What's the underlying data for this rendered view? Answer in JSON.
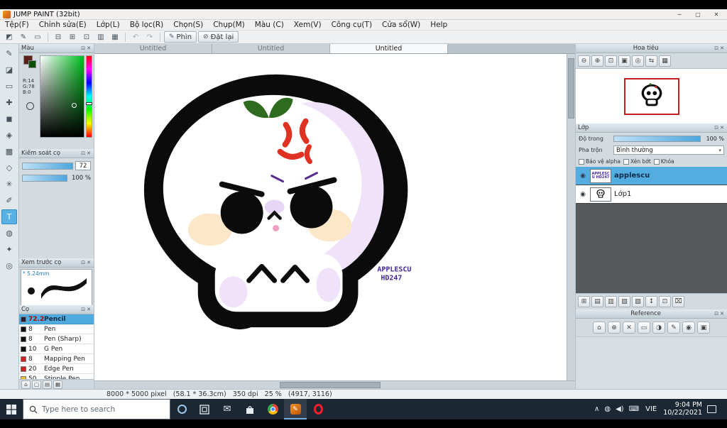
{
  "window": {
    "title": "JUMP PAINT (32bit)",
    "controls": {
      "minimize": "─",
      "maximize": "▢",
      "close": "✕"
    }
  },
  "ui": {
    "float_glyph": "⊡",
    "close_glyph": "✕"
  },
  "menu": {
    "items": [
      "Tệp(F)",
      "Chỉnh sửa(E)",
      "Lớp(L)",
      "Bộ lọc(R)",
      "Chọn(S)",
      "Chụp(M)",
      "Màu (C)",
      "Xem(V)",
      "Công cụ(T)",
      "Cửa sổ(W)",
      "Help"
    ]
  },
  "toolbar": {
    "icons": [
      {
        "name": "palette-icon",
        "glyph": "◩"
      },
      {
        "name": "brush-settings-icon",
        "glyph": "✎"
      },
      {
        "name": "comment-icon",
        "glyph": "▭"
      },
      {
        "name": "layout-left-icon",
        "glyph": "⊟"
      },
      {
        "name": "layout-grid-icon",
        "glyph": "⊞"
      },
      {
        "name": "layout-right-icon",
        "glyph": "⊡"
      },
      {
        "name": "layout-rows-icon",
        "glyph": "▥"
      },
      {
        "name": "materials-icon",
        "glyph": "▦"
      }
    ],
    "undo_glyph": "↶",
    "redo_glyph": "↷",
    "pen_glyph": "✎",
    "pen_button": "Phìn",
    "reset_glyph": "⊘",
    "reset_button": "Đặt lại"
  },
  "tools": {
    "items": [
      {
        "name": "pen-tool",
        "glyph": "✎"
      },
      {
        "name": "eraser-tool",
        "glyph": "◪"
      },
      {
        "name": "marquee-tool",
        "glyph": "▭"
      },
      {
        "name": "move-tool",
        "glyph": "✚"
      },
      {
        "name": "fill-tool",
        "glyph": "◼"
      },
      {
        "name": "bucket-tool",
        "glyph": "◈"
      },
      {
        "name": "gradient-tool",
        "glyph": "▩"
      },
      {
        "name": "lasso-tool",
        "glyph": "◇"
      },
      {
        "name": "wand-tool",
        "glyph": "✳"
      },
      {
        "name": "select-pen-tool",
        "glyph": "✐"
      },
      {
        "name": "text-tool",
        "glyph": "T",
        "active": true
      },
      {
        "name": "eyedropper-tool",
        "glyph": "◍"
      },
      {
        "name": "hand-tool",
        "glyph": "✦"
      },
      {
        "name": "zoom-tool",
        "glyph": "◎"
      }
    ]
  },
  "color_panel": {
    "title": "Màu",
    "r": "R:14",
    "g": "G:78",
    "b": "B:0",
    "foreground_swatch": "#0e4e00"
  },
  "brush_control": {
    "title": "Kiểm soát cọ",
    "size_value": "72",
    "opacity_value": "100 %"
  },
  "brush_preview": {
    "title": "Xem trước cọ",
    "size_label": "* 5.24mm"
  },
  "brush_list": {
    "title": "Cọ",
    "brushes": [
      {
        "size": "72.2",
        "name": "Pencil",
        "swatch": "#20203a",
        "selected": true
      },
      {
        "size": "8",
        "name": "Pen",
        "swatch": "#101010",
        "selected": false
      },
      {
        "size": "8",
        "name": "Pen (Sharp)",
        "swatch": "#101010",
        "selected": false
      },
      {
        "size": "10",
        "name": "G Pen",
        "swatch": "#101010",
        "selected": false
      },
      {
        "size": "8",
        "name": "Mapping Pen",
        "swatch": "#cc2222",
        "selected": false
      },
      {
        "size": "20",
        "name": "Edge Pen",
        "swatch": "#cc2222",
        "selected": false
      },
      {
        "size": "50",
        "name": "Stipple Pen",
        "swatch": "#e8c42a",
        "selected": false
      }
    ]
  },
  "left_bottom_buttons": [
    {
      "name": "home-icon",
      "glyph": "⌂"
    },
    {
      "name": "canvas-icon",
      "glyph": "▢"
    },
    {
      "name": "pages-icon",
      "glyph": "▤"
    },
    {
      "name": "materials-icon",
      "glyph": "▦"
    }
  ],
  "canvas": {
    "tabs": [
      {
        "label": "Untitled",
        "active": false
      },
      {
        "label": "Untitled",
        "active": false
      },
      {
        "label": "Untitled",
        "active": true
      }
    ],
    "signature_line1": "APPLESCU",
    "signature_line2": "HD247"
  },
  "navigator": {
    "title": "Hoa tiêu",
    "buttons": [
      {
        "name": "zoom-out-icon",
        "glyph": "⊖"
      },
      {
        "name": "zoom-in-icon",
        "glyph": "⊕"
      },
      {
        "name": "fit-window-icon",
        "glyph": "⊡"
      },
      {
        "name": "actual-size-icon",
        "glyph": "▣"
      },
      {
        "name": "reset-view-icon",
        "glyph": "◎"
      },
      {
        "name": "flip-icon",
        "glyph": "⇆"
      },
      {
        "name": "options-icon",
        "glyph": "▦"
      }
    ]
  },
  "layers": {
    "title": "Lớp",
    "opacity_label": "Độ trong",
    "opacity_value": "100 %",
    "blend_label": "Pha trộn",
    "blend_value": "Bình thường",
    "checkboxes": [
      {
        "label": "Bảo vệ alpha"
      },
      {
        "label": "Xén bớt"
      },
      {
        "label": "Khóa"
      }
    ],
    "items": [
      {
        "name": "applescu",
        "selected": true,
        "thumb_text": "APPLESCU HD247"
      },
      {
        "name": "Lớp1",
        "selected": false
      }
    ],
    "buttons": [
      {
        "name": "new-layer-icon",
        "glyph": "⊞"
      },
      {
        "name": "new-folder-icon",
        "glyph": "▤"
      },
      {
        "name": "duplicate-layer-icon",
        "glyph": "▥"
      },
      {
        "name": "clipping-icon",
        "glyph": "▧"
      },
      {
        "name": "merge-icon",
        "glyph": "▨"
      },
      {
        "name": "reorder-icon",
        "glyph": "↕"
      },
      {
        "name": "layer-settings-icon",
        "glyph": "⊡"
      },
      {
        "name": "delete-layer-icon",
        "glyph": "⌧"
      }
    ]
  },
  "reference": {
    "title": "Reference",
    "buttons": [
      {
        "name": "home-icon",
        "glyph": "⌂"
      },
      {
        "name": "add-icon",
        "glyph": "⊕"
      },
      {
        "name": "clear-icon",
        "glyph": "✕"
      },
      {
        "name": "frame-icon",
        "glyph": "▭"
      },
      {
        "name": "tone-icon",
        "glyph": "◑"
      },
      {
        "name": "pen-icon",
        "glyph": "✎"
      },
      {
        "name": "target-icon",
        "glyph": "◉"
      },
      {
        "name": "grid-icon",
        "glyph": "▣"
      }
    ]
  },
  "statusbar": {
    "text": "8000 * 5000 pixel   (58.1 * 36.3cm)   350 dpi   25 %   (4917, 3116)"
  },
  "taskbar": {
    "search_placeholder": "Type here to search",
    "language": "VIE",
    "time": "9:04 PM",
    "date": "10/22/2021",
    "tray_icons": [
      {
        "name": "hidden-icons-chevron",
        "glyph": "∧"
      },
      {
        "name": "network-icon",
        "glyph": "◍"
      },
      {
        "name": "speaker-icon",
        "glyph": "◀)"
      },
      {
        "name": "touch-keyboard-icon",
        "glyph": "⌨"
      }
    ]
  },
  "colors": {
    "selection_blue": "#53ade0",
    "anger_red": "#e03222",
    "lavender": "#f0e2fa",
    "sprout_green": "#2e6b1e",
    "signature_purple": "#4527a0",
    "cheek_peach": "#fce8c8",
    "taskbar_dark": "#1b2733"
  }
}
